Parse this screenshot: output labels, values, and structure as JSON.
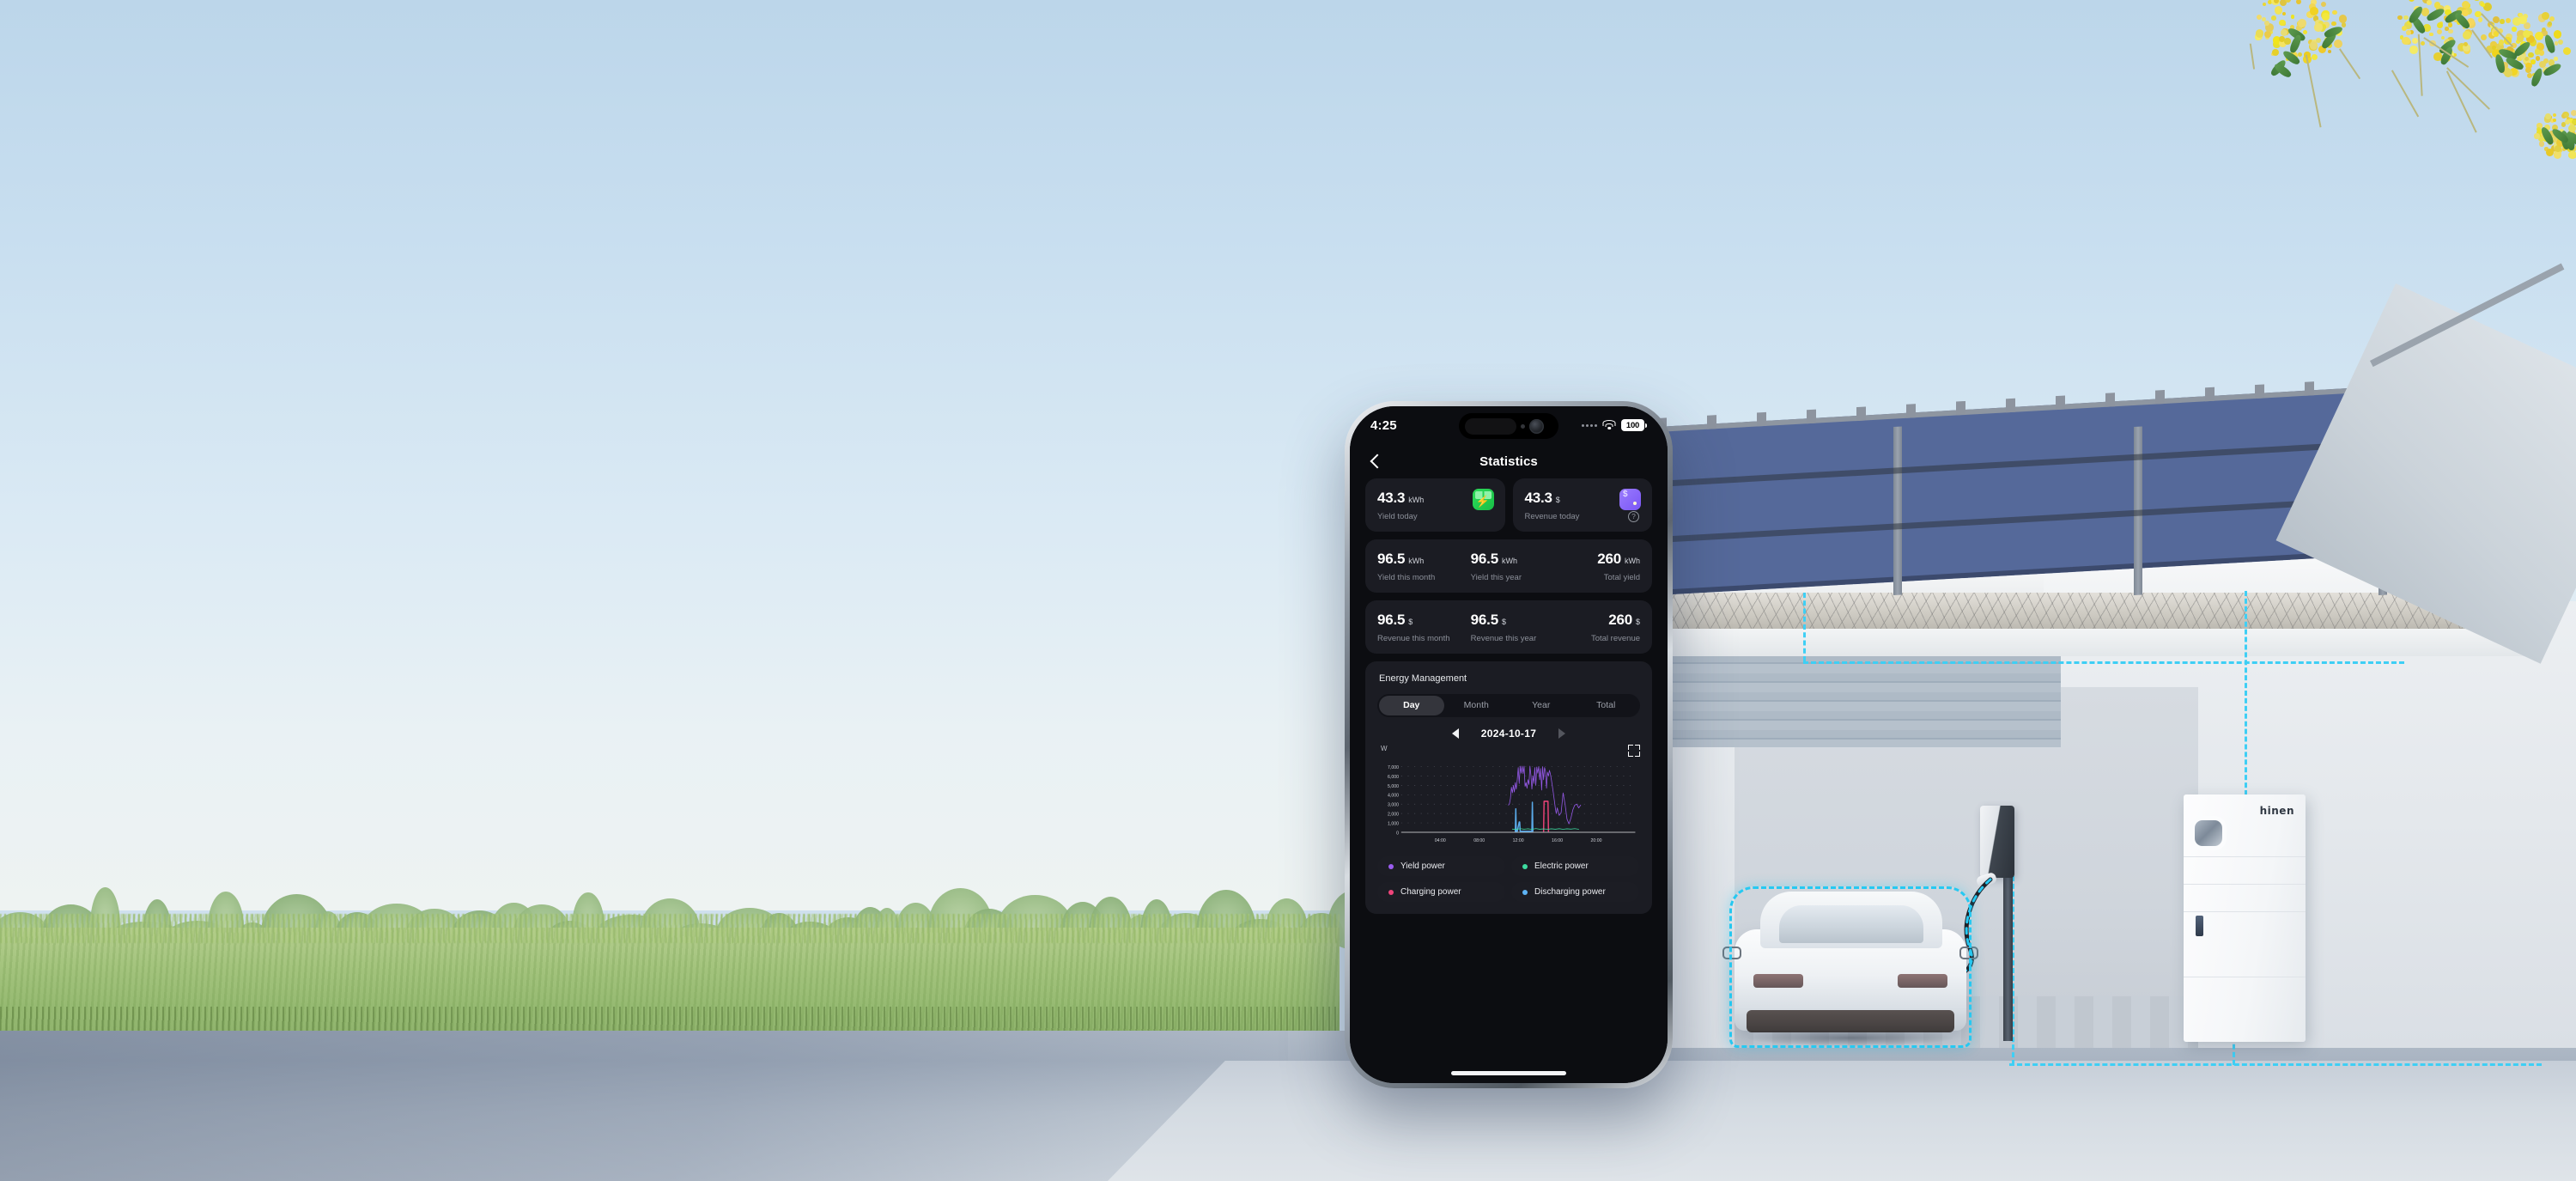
{
  "scene": {
    "description": "Modern home exterior with rooftop solar array, wall EV charger, white electric car, and hinen home battery",
    "battery_unit_brand": "hinen",
    "flow_line_color": "#26c9f2",
    "sky_color": "#bcd6ea"
  },
  "phone": {
    "status_bar": {
      "time": "4:25",
      "battery_level": "100",
      "wifi_icon": "wifi-icon",
      "signal_icon": "signal-dots-icon",
      "battery_icon": "battery-icon"
    },
    "nav": {
      "back_icon": "back-chevron-icon",
      "title": "Statistics"
    },
    "today_cards": [
      {
        "value": "43.3",
        "unit": "kWh",
        "label": "Yield today",
        "icon": "solar-panel-icon",
        "icon_color": "#1fc94d"
      },
      {
        "value": "43.3",
        "unit": "$",
        "label": "Revenue today",
        "icon": "wallet-icon",
        "icon_color": "#7e5cf6",
        "help_icon": "help-circle-icon"
      }
    ],
    "yield_card": [
      {
        "value": "96.5",
        "unit": "kWh",
        "label": "Yield this month"
      },
      {
        "value": "96.5",
        "unit": "kWh",
        "label": "Yield this year"
      },
      {
        "value": "260",
        "unit": "kWh",
        "label": "Total yield"
      }
    ],
    "revenue_card": [
      {
        "value": "96.5",
        "unit": "$",
        "label": "Revenue this month"
      },
      {
        "value": "96.5",
        "unit": "$",
        "label": "Revenue this year"
      },
      {
        "value": "260",
        "unit": "$",
        "label": "Total revenue"
      }
    ],
    "energy": {
      "section_title": "Energy Management",
      "tabs": [
        {
          "label": "Day",
          "active": true
        },
        {
          "label": "Month",
          "active": false
        },
        {
          "label": "Year",
          "active": false
        },
        {
          "label": "Total",
          "active": false
        }
      ],
      "date": "2024-10-17",
      "prev_icon": "triangle-left-icon",
      "next_icon": "triangle-right-icon",
      "expand_icon": "fullscreen-expand-icon"
    },
    "legend": [
      {
        "label": "Yield power",
        "color": "#9b5cf0"
      },
      {
        "label": "Electric power",
        "color": "#3ddca0"
      },
      {
        "label": "Charging power",
        "color": "#f0447a"
      },
      {
        "label": "Discharging power",
        "color": "#5eb3f5"
      }
    ],
    "home_indicator": "home-indicator"
  },
  "chart_data": {
    "type": "line",
    "title": "Energy Management",
    "xlabel": "",
    "ylabel": "W",
    "unit": "W",
    "grid": "dotted",
    "legend_position": "below",
    "ylim": [
      0,
      7600
    ],
    "yticks": [
      0,
      1000,
      2000,
      3000,
      4000,
      5000,
      6000,
      7000
    ],
    "ytick_labels": [
      "0",
      "1,000",
      "2,000",
      "3,000",
      "4,000",
      "5,000",
      "6,000",
      "7,000"
    ],
    "xlim": [
      0,
      24
    ],
    "xticks": [
      4,
      8,
      12,
      16,
      20
    ],
    "xtick_labels": [
      "04:00",
      "08:00",
      "12:00",
      "16:00",
      "20:00"
    ],
    "series": [
      {
        "name": "Yield power",
        "color": "#9b5cf0",
        "x": [
          11.0,
          11.1,
          11.2,
          11.3,
          11.4,
          11.5,
          11.6,
          11.7,
          11.8,
          11.9,
          12.0,
          12.1,
          12.2,
          12.3,
          12.4,
          12.5,
          12.6,
          12.7,
          12.8,
          12.9,
          13.0,
          13.1,
          13.2,
          13.3,
          13.4,
          13.5,
          13.6,
          13.7,
          13.8,
          13.9,
          14.0,
          14.1,
          14.2,
          14.3,
          14.4,
          14.5,
          14.6,
          14.7,
          14.8,
          14.9,
          15.0,
          15.1,
          15.2,
          15.3,
          15.4,
          15.5,
          15.6,
          15.7,
          15.8,
          15.9,
          16.0,
          16.2,
          16.4,
          16.6,
          16.8,
          17.0,
          17.2,
          17.4,
          17.6,
          17.8,
          18.0,
          18.2,
          18.4
        ],
        "y": [
          2900,
          3050,
          3600,
          4800,
          4200,
          5000,
          4300,
          5300,
          4600,
          5600,
          6900,
          5200,
          7050,
          6300,
          7050,
          6250,
          7050,
          4900,
          5300,
          4700,
          5600,
          5100,
          7050,
          6100,
          4600,
          6000,
          5200,
          6900,
          5000,
          6950,
          6300,
          7000,
          5600,
          6800,
          4500,
          7000,
          5600,
          6900,
          6500,
          4700,
          6400,
          6000,
          6600,
          6200,
          5600,
          4900,
          4200,
          3400,
          2600,
          2000,
          2600,
          1800,
          2100,
          4200,
          3000,
          1400,
          900,
          1500,
          2400,
          2900,
          3000,
          2600,
          2900
        ]
      },
      {
        "name": "Discharging power",
        "color": "#5eb3f5",
        "x": [
          11.7,
          11.75,
          11.8,
          11.9,
          12.1,
          12.15,
          12.2,
          13.4,
          13.45,
          13.5
        ],
        "y": [
          100,
          2500,
          100,
          100,
          1100,
          1100,
          100,
          100,
          3200,
          120
        ]
      },
      {
        "name": "Charging power",
        "color": "#f0447a",
        "x": [
          14.6,
          14.65,
          14.7,
          15.0,
          15.05,
          15.1
        ],
        "y": [
          100,
          3300,
          3300,
          3300,
          3300,
          100
        ]
      },
      {
        "name": "Electric power",
        "color": "#3ddca0",
        "x": [
          11.4,
          11.8,
          12.2,
          12.6,
          13.0,
          13.4,
          13.8,
          14.2,
          14.6,
          15.0,
          15.4,
          15.8,
          16.2,
          16.6,
          17.0,
          17.4,
          17.8,
          18.2
        ],
        "y": [
          340,
          300,
          390,
          330,
          370,
          310,
          400,
          330,
          360,
          320,
          370,
          330,
          380,
          320,
          370,
          340,
          390,
          320
        ]
      }
    ]
  }
}
